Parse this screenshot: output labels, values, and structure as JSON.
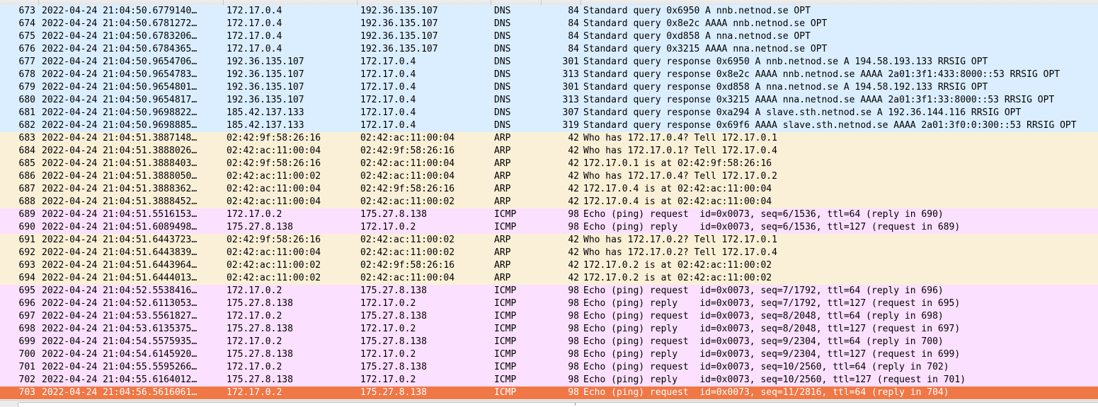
{
  "colors": {
    "dns": "#daeeff",
    "arp": "#faf0d7",
    "icmp": "#fce0ff",
    "selected": "#f07746"
  },
  "packets": [
    {
      "no": "673",
      "time": "2022-04-24 21:04:50.6779140…",
      "source": "172.17.0.4",
      "destination": "192.36.135.107",
      "protocol": "DNS",
      "length": "84",
      "info": "Standard query 0x6950 A nnb.netnod.se OPT"
    },
    {
      "no": "674",
      "time": "2022-04-24 21:04:50.6781272…",
      "source": "172.17.0.4",
      "destination": "192.36.135.107",
      "protocol": "DNS",
      "length": "84",
      "info": "Standard query 0x8e2c AAAA nnb.netnod.se OPT"
    },
    {
      "no": "675",
      "time": "2022-04-24 21:04:50.6783206…",
      "source": "172.17.0.4",
      "destination": "192.36.135.107",
      "protocol": "DNS",
      "length": "84",
      "info": "Standard query 0xd858 A nna.netnod.se OPT"
    },
    {
      "no": "676",
      "time": "2022-04-24 21:04:50.6784365…",
      "source": "172.17.0.4",
      "destination": "192.36.135.107",
      "protocol": "DNS",
      "length": "84",
      "info": "Standard query 0x3215 AAAA nna.netnod.se OPT"
    },
    {
      "no": "677",
      "time": "2022-04-24 21:04:50.9654706…",
      "source": "192.36.135.107",
      "destination": "172.17.0.4",
      "protocol": "DNS",
      "length": "301",
      "info": "Standard query response 0x6950 A nnb.netnod.se A 194.58.193.133 RRSIG OPT"
    },
    {
      "no": "678",
      "time": "2022-04-24 21:04:50.9654783…",
      "source": "192.36.135.107",
      "destination": "172.17.0.4",
      "protocol": "DNS",
      "length": "313",
      "info": "Standard query response 0x8e2c AAAA nnb.netnod.se AAAA 2a01:3f1:433:8000::53 RRSIG OPT"
    },
    {
      "no": "679",
      "time": "2022-04-24 21:04:50.9654801…",
      "source": "192.36.135.107",
      "destination": "172.17.0.4",
      "protocol": "DNS",
      "length": "301",
      "info": "Standard query response 0xd858 A nna.netnod.se A 194.58.192.133 RRSIG OPT"
    },
    {
      "no": "680",
      "time": "2022-04-24 21:04:50.9654817…",
      "source": "192.36.135.107",
      "destination": "172.17.0.4",
      "protocol": "DNS",
      "length": "313",
      "info": "Standard query response 0x3215 AAAA nna.netnod.se AAAA 2a01:3f1:33:8000::53 RRSIG OPT"
    },
    {
      "no": "681",
      "time": "2022-04-24 21:04:50.9698822…",
      "source": "185.42.137.133",
      "destination": "172.17.0.4",
      "protocol": "DNS",
      "length": "307",
      "info": "Standard query response 0xa294 A slave.sth.netnod.se A 192.36.144.116 RRSIG OPT"
    },
    {
      "no": "682",
      "time": "2022-04-24 21:04:50.9698885…",
      "source": "185.42.137.133",
      "destination": "172.17.0.4",
      "protocol": "DNS",
      "length": "319",
      "info": "Standard query response 0x69f6 AAAA slave.sth.netnod.se AAAA 2a01:3f0:0:300::53 RRSIG OPT"
    },
    {
      "no": "683",
      "time": "2022-04-24 21:04:51.3887148…",
      "source": "02:42:9f:58:26:16",
      "destination": "02:42:ac:11:00:04",
      "protocol": "ARP",
      "length": "42",
      "info": "Who has 172.17.0.4? Tell 172.17.0.1"
    },
    {
      "no": "684",
      "time": "2022-04-24 21:04:51.3888026…",
      "source": "02:42:ac:11:00:04",
      "destination": "02:42:9f:58:26:16",
      "protocol": "ARP",
      "length": "42",
      "info": "Who has 172.17.0.1? Tell 172.17.0.4"
    },
    {
      "no": "685",
      "time": "2022-04-24 21:04:51.3888403…",
      "source": "02:42:9f:58:26:16",
      "destination": "02:42:ac:11:00:04",
      "protocol": "ARP",
      "length": "42",
      "info": "172.17.0.1 is at 02:42:9f:58:26:16"
    },
    {
      "no": "686",
      "time": "2022-04-24 21:04:51.3888050…",
      "source": "02:42:ac:11:00:02",
      "destination": "02:42:ac:11:00:04",
      "protocol": "ARP",
      "length": "42",
      "info": "Who has 172.17.0.4? Tell 172.17.0.2"
    },
    {
      "no": "687",
      "time": "2022-04-24 21:04:51.3888362…",
      "source": "02:42:ac:11:00:04",
      "destination": "02:42:9f:58:26:16",
      "protocol": "ARP",
      "length": "42",
      "info": "172.17.0.4 is at 02:42:ac:11:00:04"
    },
    {
      "no": "688",
      "time": "2022-04-24 21:04:51.3888452…",
      "source": "02:42:ac:11:00:04",
      "destination": "02:42:ac:11:00:02",
      "protocol": "ARP",
      "length": "42",
      "info": "172.17.0.4 is at 02:42:ac:11:00:04"
    },
    {
      "no": "689",
      "time": "2022-04-24 21:04:51.5516153…",
      "source": "172.17.0.2",
      "destination": "175.27.8.138",
      "protocol": "ICMP",
      "length": "98",
      "info": "Echo (ping) request  id=0x0073, seq=6/1536, ttl=64 (reply in 690)"
    },
    {
      "no": "690",
      "time": "2022-04-24 21:04:51.6089498…",
      "source": "175.27.8.138",
      "destination": "172.17.0.2",
      "protocol": "ICMP",
      "length": "98",
      "info": "Echo (ping) reply    id=0x0073, seq=6/1536, ttl=127 (request in 689)"
    },
    {
      "no": "691",
      "time": "2022-04-24 21:04:51.6443723…",
      "source": "02:42:9f:58:26:16",
      "destination": "02:42:ac:11:00:02",
      "protocol": "ARP",
      "length": "42",
      "info": "Who has 172.17.0.2? Tell 172.17.0.1"
    },
    {
      "no": "692",
      "time": "2022-04-24 21:04:51.6443839…",
      "source": "02:42:ac:11:00:04",
      "destination": "02:42:ac:11:00:02",
      "protocol": "ARP",
      "length": "42",
      "info": "Who has 172.17.0.2? Tell 172.17.0.4"
    },
    {
      "no": "693",
      "time": "2022-04-24 21:04:51.6443964…",
      "source": "02:42:ac:11:00:02",
      "destination": "02:42:9f:58:26:16",
      "protocol": "ARP",
      "length": "42",
      "info": "172.17.0.2 is at 02:42:ac:11:00:02"
    },
    {
      "no": "694",
      "time": "2022-04-24 21:04:51.6444013…",
      "source": "02:42:ac:11:00:02",
      "destination": "02:42:ac:11:00:04",
      "protocol": "ARP",
      "length": "42",
      "info": "172.17.0.2 is at 02:42:ac:11:00:02"
    },
    {
      "no": "695",
      "time": "2022-04-24 21:04:52.5538416…",
      "source": "172.17.0.2",
      "destination": "175.27.8.138",
      "protocol": "ICMP",
      "length": "98",
      "info": "Echo (ping) request  id=0x0073, seq=7/1792, ttl=64 (reply in 696)"
    },
    {
      "no": "696",
      "time": "2022-04-24 21:04:52.6113053…",
      "source": "175.27.8.138",
      "destination": "172.17.0.2",
      "protocol": "ICMP",
      "length": "98",
      "info": "Echo (ping) reply    id=0x0073, seq=7/1792, ttl=127 (request in 695)"
    },
    {
      "no": "697",
      "time": "2022-04-24 21:04:53.5561827…",
      "source": "172.17.0.2",
      "destination": "175.27.8.138",
      "protocol": "ICMP",
      "length": "98",
      "info": "Echo (ping) request  id=0x0073, seq=8/2048, ttl=64 (reply in 698)"
    },
    {
      "no": "698",
      "time": "2022-04-24 21:04:53.6135375…",
      "source": "175.27.8.138",
      "destination": "172.17.0.2",
      "protocol": "ICMP",
      "length": "98",
      "info": "Echo (ping) reply    id=0x0073, seq=8/2048, ttl=127 (request in 697)"
    },
    {
      "no": "699",
      "time": "2022-04-24 21:04:54.5575935…",
      "source": "172.17.0.2",
      "destination": "175.27.8.138",
      "protocol": "ICMP",
      "length": "98",
      "info": "Echo (ping) request  id=0x0073, seq=9/2304, ttl=64 (reply in 700)"
    },
    {
      "no": "700",
      "time": "2022-04-24 21:04:54.6145920…",
      "source": "175.27.8.138",
      "destination": "172.17.0.2",
      "protocol": "ICMP",
      "length": "98",
      "info": "Echo (ping) reply    id=0x0073, seq=9/2304, ttl=127 (request in 699)"
    },
    {
      "no": "701",
      "time": "2022-04-24 21:04:55.5595266…",
      "source": "172.17.0.2",
      "destination": "175.27.8.138",
      "protocol": "ICMP",
      "length": "98",
      "info": "Echo (ping) request  id=0x0073, seq=10/2560, ttl=64 (reply in 702)"
    },
    {
      "no": "702",
      "time": "2022-04-24 21:04:55.6164012…",
      "source": "175.27.8.138",
      "destination": "172.17.0.2",
      "protocol": "ICMP",
      "length": "98",
      "info": "Echo (ping) reply    id=0x0073, seq=10/2560, ttl=127 (request in 701)"
    },
    {
      "no": "703",
      "time": "2022-04-24 21:04:56.5616061…",
      "source": "172.17.0.2",
      "destination": "175.27.8.138",
      "protocol": "ICMP",
      "length": "98",
      "info": "Echo (ping) request  id=0x0073, seq=11/2816, ttl=64 (reply in 704)",
      "selected": true
    }
  ]
}
